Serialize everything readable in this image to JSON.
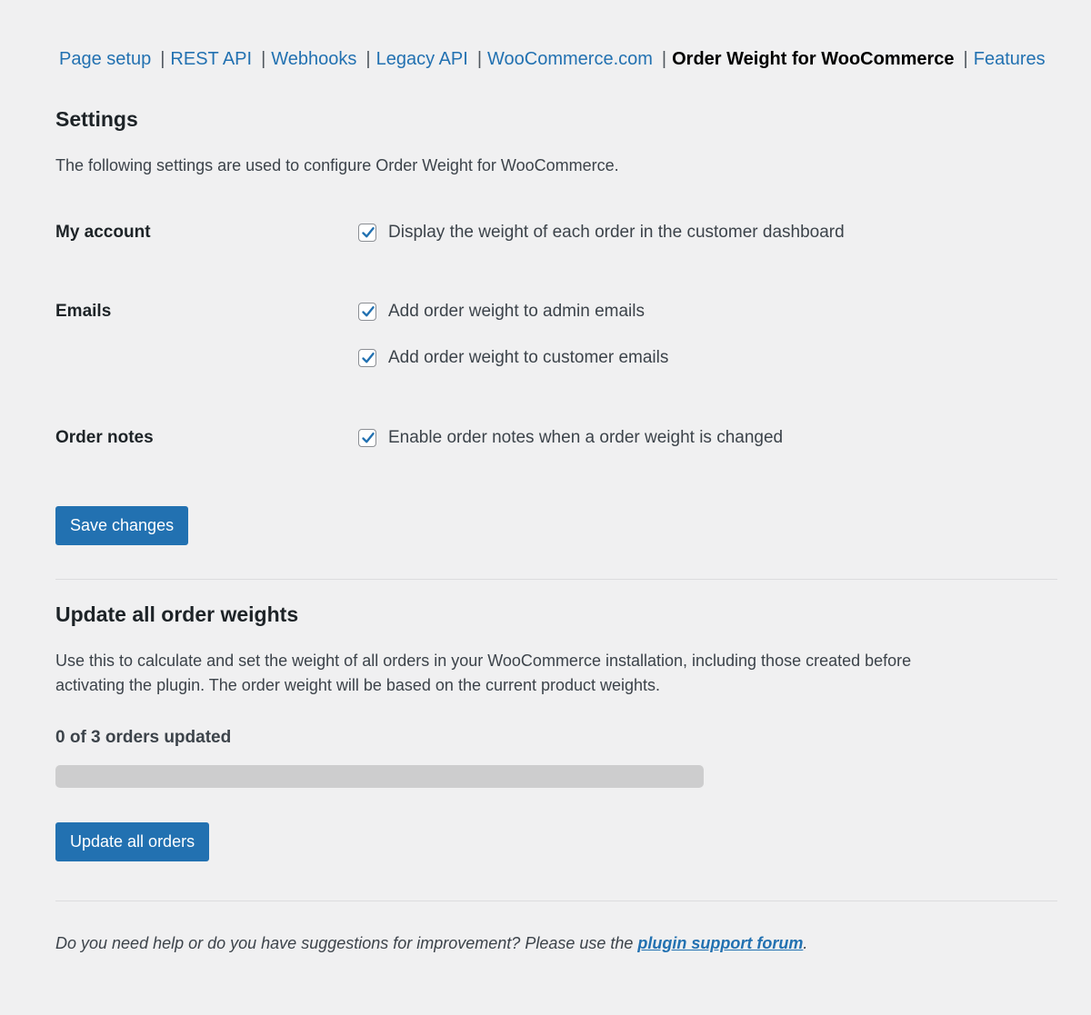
{
  "nav": {
    "items": [
      {
        "label": "Page setup",
        "current": false
      },
      {
        "label": "REST API",
        "current": false
      },
      {
        "label": "Webhooks",
        "current": false
      },
      {
        "label": "Legacy API",
        "current": false
      },
      {
        "label": "WooCommerce.com",
        "current": false
      },
      {
        "label": "Order Weight for WooCommerce",
        "current": true
      },
      {
        "label": "Features",
        "current": false
      }
    ],
    "separator": "|"
  },
  "settings": {
    "title": "Settings",
    "description": "The following settings are used to configure Order Weight for WooCommerce.",
    "my_account": {
      "label": "My account",
      "options": [
        {
          "label": "Display the weight of each order in the customer dashboard",
          "checked": true
        }
      ]
    },
    "emails": {
      "label": "Emails",
      "options": [
        {
          "label": "Add order weight to admin emails",
          "checked": true
        },
        {
          "label": "Add order weight to customer emails",
          "checked": true
        }
      ]
    },
    "order_notes": {
      "label": "Order notes",
      "options": [
        {
          "label": "Enable order notes when a order weight is changed",
          "checked": true
        }
      ]
    },
    "save_label": "Save changes"
  },
  "update": {
    "title": "Update all order weights",
    "description_line1": "Use this to calculate and set the weight of all orders in your WooCommerce installation, including those created before",
    "description_line2": "activating the plugin. The order weight will be based on the current product weights.",
    "progress_text": "0 of 3 orders updated",
    "progress": {
      "done": 0,
      "total": 3
    },
    "button_label": "Update all orders"
  },
  "footer": {
    "text_before": "Do you need help or do you have suggestions for improvement? Please use the ",
    "link_label": "plugin support forum",
    "text_after": "."
  },
  "colors": {
    "accent": "#2271b1",
    "background": "#f0f0f1",
    "progress_track": "#cdcdce"
  }
}
